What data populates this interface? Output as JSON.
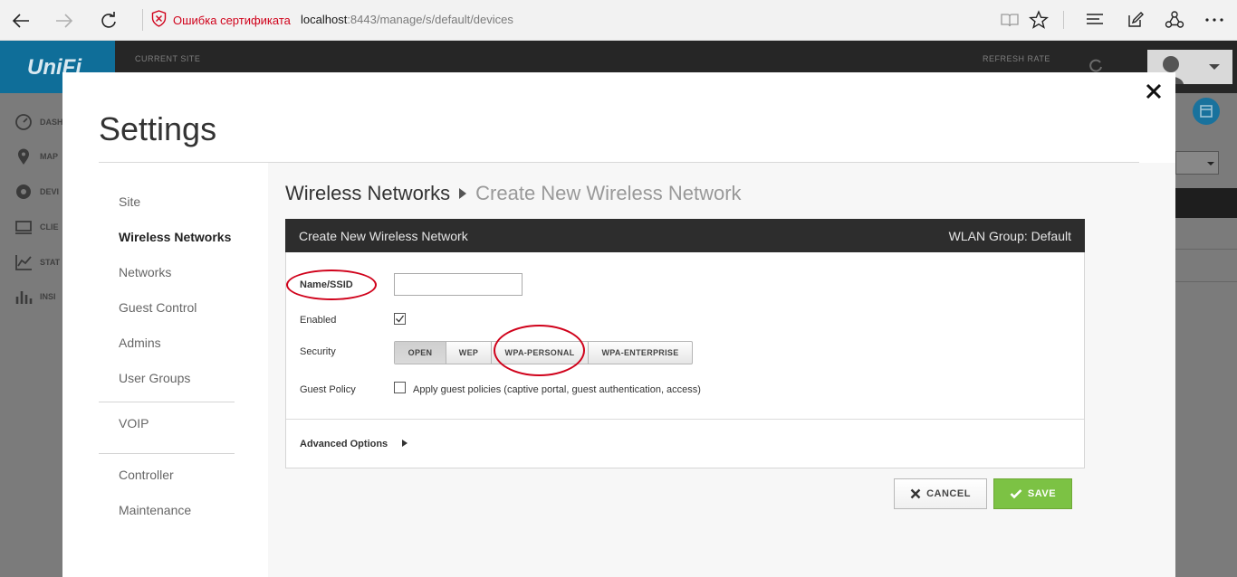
{
  "browser": {
    "cert_warning": "Ошибка сертификата",
    "url_host": "localhost",
    "url_rest": ":8443/manage/s/default/devices",
    "icons": [
      "back-icon",
      "forward-icon",
      "refresh-icon",
      "shield-icon",
      "reading-view-icon",
      "favorite-star-icon",
      "hub-icon",
      "web-note-icon",
      "share-icon",
      "more-icon"
    ]
  },
  "app": {
    "logo": "UniFi",
    "current_site_caption": "CURRENT SITE",
    "refresh_rate_caption": "REFRESH RATE",
    "sidebar": [
      "DASH",
      "MAP",
      "DEVI",
      "CLIE",
      "STAT",
      "INSI"
    ]
  },
  "modal": {
    "title": "Settings",
    "nav": {
      "items": [
        "Site",
        "Wireless Networks",
        "Networks",
        "Guest Control",
        "Admins",
        "User Groups"
      ],
      "voip": "VOIP",
      "bottom": [
        "Controller",
        "Maintenance"
      ],
      "active": "Wireless Networks"
    },
    "breadcrumb": {
      "parent": "Wireless Networks",
      "current": "Create New Wireless Network"
    },
    "panel": {
      "title": "Create New Wireless Network",
      "wlan_group": "WLAN Group: Default"
    },
    "form": {
      "name_label": "Name/SSID",
      "name_value": "",
      "enabled_label": "Enabled",
      "enabled_checked": true,
      "security_label": "Security",
      "security_options": [
        "OPEN",
        "WEP",
        "WPA-PERSONAL",
        "WPA-ENTERPRISE"
      ],
      "security_selected": "OPEN",
      "guest_policy_label": "Guest Policy",
      "guest_policy_text": "Apply guest policies (captive portal, guest authentication, access)",
      "guest_policy_checked": false,
      "advanced_label": "Advanced Options"
    },
    "buttons": {
      "cancel": "CANCEL",
      "save": "SAVE"
    }
  },
  "colors": {
    "annotation_red": "#d0021b",
    "save_green": "#7cc244",
    "header_dark": "#2d2d2d",
    "unifi_blue": "#0f6e99"
  }
}
